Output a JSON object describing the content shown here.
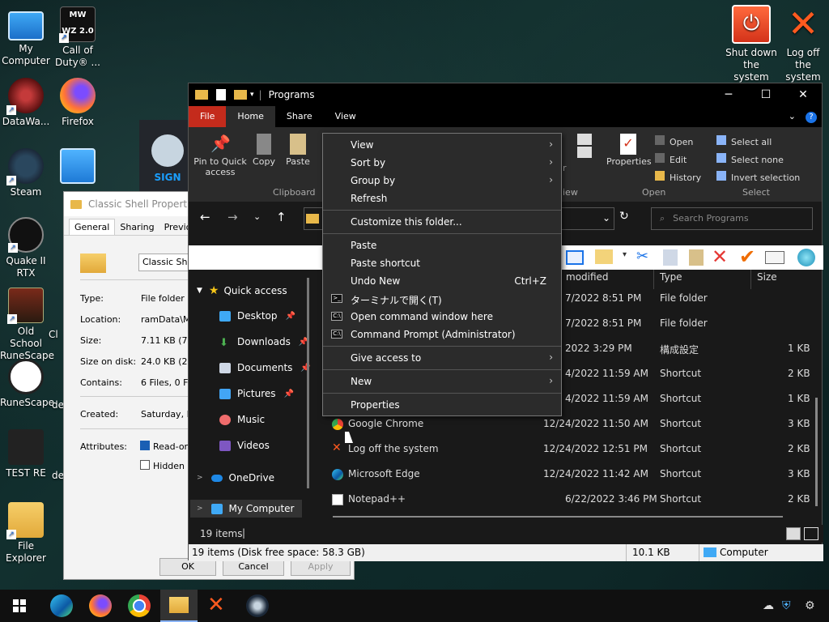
{
  "desktop": {
    "icons": [
      {
        "label": "My Computer"
      },
      {
        "label": "Call of Duty® ..."
      },
      {
        "label": "DataWa..."
      },
      {
        "label": "Firefox"
      },
      {
        "label": "Steam"
      },
      {
        "label": "Quake II RTX"
      },
      {
        "label": "Old School RuneScape"
      },
      {
        "label": "RuneScape"
      },
      {
        "label": "TEST RE"
      },
      {
        "label": "File Explorer"
      }
    ],
    "partial_labels": [
      "Cl",
      "de",
      "de"
    ],
    "shutdown": "Shut down the system",
    "logoff": "Log off the system",
    "cod_badge": "MW WZ 2.0",
    "steam_sign": "SIGN"
  },
  "props": {
    "title": "Classic Shell Properties",
    "tabs": [
      "General",
      "Sharing",
      "Previous"
    ],
    "name_value": "Classic Shel",
    "rows": [
      {
        "label": "Type:",
        "value": "File folder"
      },
      {
        "label": "Location:",
        "value": "ramData\\Mic"
      },
      {
        "label": "Size:",
        "value": "7.11 KB (7,2"
      },
      {
        "label": "Size on disk:",
        "value": "24.0 KB (24"
      },
      {
        "label": "Contains:",
        "value": "6 Files, 0 Fo"
      },
      {
        "label": "Created:",
        "value": "Saturday, D"
      }
    ],
    "attributes_label": "Attributes:",
    "readonly": "Read-only",
    "hidden": "Hidden",
    "ok": "OK",
    "cancel": "Cancel",
    "apply": "Apply"
  },
  "explorer": {
    "title": "Programs",
    "ribbon_tabs": [
      "File",
      "Home",
      "Share",
      "View"
    ],
    "ribbon": {
      "pin": "Pin to Quick access",
      "copy": "Copy",
      "paste": "Paste",
      "clipboard": "Clipboard",
      "properties": "Properties",
      "open": "Open",
      "edit": "Edit",
      "history": "History",
      "open_group": "Open",
      "select_all": "Select all",
      "select_none": "Select none",
      "invert": "Invert selection",
      "select_group": "Select",
      "view_partial": "iew",
      "r_partial": "r"
    },
    "search_placeholder": "Search Programs",
    "nav": [
      {
        "label": "Quick access"
      },
      {
        "label": "Desktop"
      },
      {
        "label": "Downloads"
      },
      {
        "label": "Documents"
      },
      {
        "label": "Pictures"
      },
      {
        "label": "Music"
      },
      {
        "label": "Videos"
      },
      {
        "label": "OneDrive"
      },
      {
        "label": "My Computer"
      }
    ],
    "columns": {
      "modified": "modified",
      "type": "Type",
      "size": "Size"
    },
    "rows": [
      {
        "name": "",
        "date": "7/2022 8:51 PM",
        "type": "File folder",
        "size": ""
      },
      {
        "name": "",
        "date": "7/2022 8:51 PM",
        "type": "File folder",
        "size": ""
      },
      {
        "name": "",
        "date": "2022 3:29 PM",
        "type": "構成設定",
        "size": "1 KB"
      },
      {
        "name": "",
        "date": "4/2022 11:59 AM",
        "type": "Shortcut",
        "size": "2 KB"
      },
      {
        "name": "",
        "date": "4/2022 11:59 AM",
        "type": "Shortcut",
        "size": "1 KB"
      },
      {
        "name": "Google Chrome",
        "date": "12/24/2022 11:50 AM",
        "type": "Shortcut",
        "size": "3 KB"
      },
      {
        "name": "Log off the system",
        "date": "12/24/2022 12:51 PM",
        "type": "Shortcut",
        "size": "2 KB"
      },
      {
        "name": "Microsoft Edge",
        "date": "12/24/2022 11:42 AM",
        "type": "Shortcut",
        "size": "3 KB"
      },
      {
        "name": "Notepad++",
        "date": "6/22/2022 3:46 PM",
        "type": "Shortcut",
        "size": "2 KB"
      }
    ],
    "status_items": "19 items",
    "status2_left": "19 items (Disk free space: 58.3 GB)",
    "status2_mid": "10.1 KB",
    "status2_right": "Computer"
  },
  "context_menu": {
    "view": "View",
    "sort_by": "Sort by",
    "group_by": "Group by",
    "refresh": "Refresh",
    "customize": "Customize this folder...",
    "paste": "Paste",
    "paste_shortcut": "Paste shortcut",
    "undo_new": "Undo New",
    "undo_shortcut": "Ctrl+Z",
    "terminal": "ターミナルで開く(T)",
    "open_cmd": "Open command window here",
    "cmd_admin": "Command Prompt (Administrator)",
    "give_access": "Give access to",
    "new": "New",
    "properties": "Properties"
  },
  "colors": {
    "accent_file_tab": "#c42b1c",
    "menu_bg": "#2b2b2b",
    "explorer_bg": "#191919"
  }
}
